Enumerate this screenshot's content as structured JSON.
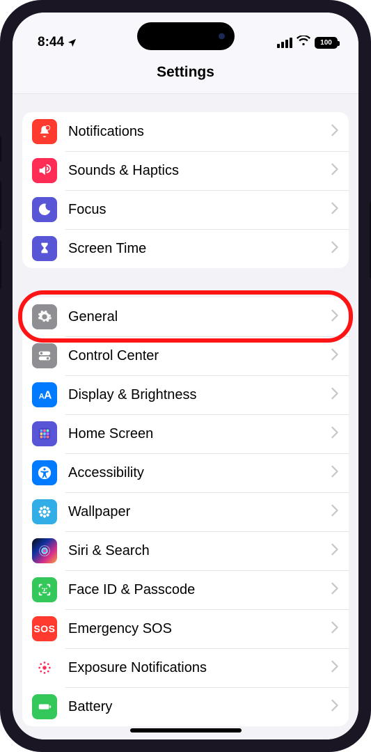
{
  "status": {
    "time": "8:44",
    "battery": "100"
  },
  "navTitle": "Settings",
  "groups": [
    {
      "id": "group-attention",
      "rows": [
        {
          "id": "notifications",
          "label": "Notifications",
          "icon": "bell-badge-icon",
          "bg": "bg-red"
        },
        {
          "id": "sounds",
          "label": "Sounds & Haptics",
          "icon": "speaker-icon",
          "bg": "bg-pink"
        },
        {
          "id": "focus",
          "label": "Focus",
          "icon": "moon-icon",
          "bg": "bg-indigo"
        },
        {
          "id": "screentime",
          "label": "Screen Time",
          "icon": "hourglass-icon",
          "bg": "bg-indigo"
        }
      ]
    },
    {
      "id": "group-general",
      "rows": [
        {
          "id": "general",
          "label": "General",
          "icon": "gear-icon",
          "bg": "bg-gray",
          "highlight": true
        },
        {
          "id": "controlcenter",
          "label": "Control Center",
          "icon": "toggles-icon",
          "bg": "bg-gray"
        },
        {
          "id": "display",
          "label": "Display & Brightness",
          "icon": "text-size-icon",
          "bg": "bg-blue"
        },
        {
          "id": "homescreen",
          "label": "Home Screen",
          "icon": "app-grid-icon",
          "bg": "bg-indigo"
        },
        {
          "id": "accessibility",
          "label": "Accessibility",
          "icon": "accessibility-icon",
          "bg": "bg-blue"
        },
        {
          "id": "wallpaper",
          "label": "Wallpaper",
          "icon": "flower-icon",
          "bg": "bg-teal"
        },
        {
          "id": "siri",
          "label": "Siri & Search",
          "icon": "siri-icon",
          "bg": "bg-grad"
        },
        {
          "id": "faceid",
          "label": "Face ID & Passcode",
          "icon": "faceid-icon",
          "bg": "bg-green"
        },
        {
          "id": "sos",
          "label": "Emergency SOS",
          "icon": "sos-icon",
          "bg": "bg-red"
        },
        {
          "id": "exposure",
          "label": "Exposure Notifications",
          "icon": "exposure-icon",
          "bg": "bg-white"
        },
        {
          "id": "battery",
          "label": "Battery",
          "icon": "battery-icon",
          "bg": "bg-green"
        }
      ]
    }
  ]
}
